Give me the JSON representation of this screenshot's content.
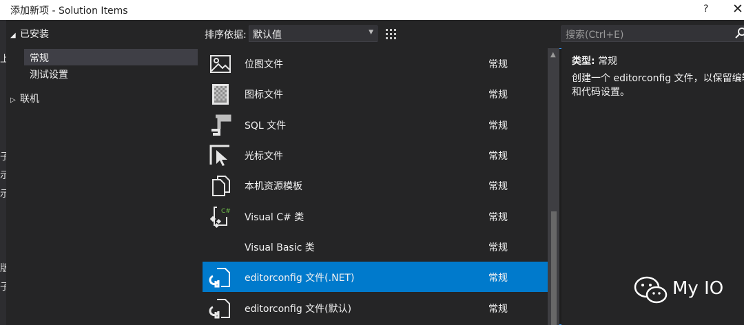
{
  "window": {
    "title": "添加新项 - Solution Items",
    "help": "?",
    "close": "✕"
  },
  "left_edge_chars": [
    "上",
    "子",
    "示",
    "示",
    "版",
    "子"
  ],
  "tree": {
    "installed_label": "已安装",
    "installed_items": [
      "常规",
      "测试设置"
    ],
    "online_label": "联机"
  },
  "toolbar": {
    "sort_label": "排序依据:",
    "sort_value": "默认值"
  },
  "templates": [
    {
      "name": "位图文件",
      "category": "常规",
      "icon": "bitmap-icon"
    },
    {
      "name": "图标文件",
      "category": "常规",
      "icon": "icon-file-icon"
    },
    {
      "name": "SQL 文件",
      "category": "常规",
      "icon": "sql-file-icon"
    },
    {
      "name": "光标文件",
      "category": "常规",
      "icon": "cursor-file-icon"
    },
    {
      "name": "本机资源模板",
      "category": "常规",
      "icon": "resource-template-icon"
    },
    {
      "name": "Visual C# 类",
      "category": "常规",
      "icon": "csharp-class-icon"
    },
    {
      "name": "Visual Basic 类",
      "category": "常规",
      "icon": ""
    },
    {
      "name": "editorconfig 文件(.NET)",
      "category": "常规",
      "icon": "editorconfig-icon",
      "selected": true
    },
    {
      "name": "editorconfig 文件(默认)",
      "category": "常规",
      "icon": "editorconfig-icon"
    }
  ],
  "search": {
    "placeholder": "搜索(Ctrl+E)"
  },
  "details": {
    "type_label": "类型:",
    "type_value": "常规",
    "description": "创建一个 editorconfig 文件，以保留编辑器和代码设置。"
  },
  "watermark": {
    "text": "My IO"
  },
  "colors": {
    "selection": "#007acc",
    "background": "#252526",
    "accent_border": "#3399ff"
  }
}
